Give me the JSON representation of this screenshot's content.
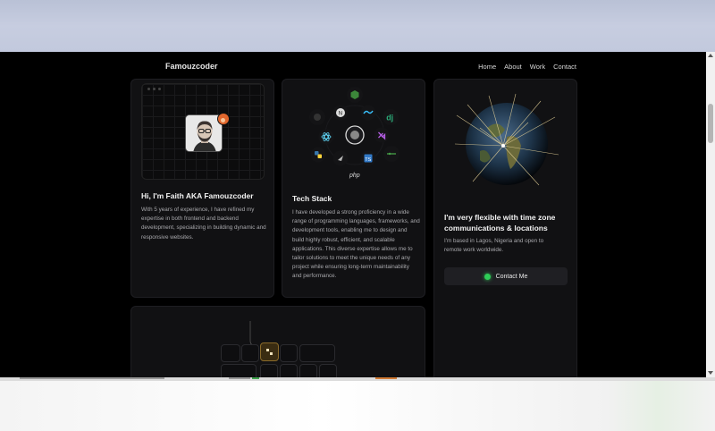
{
  "nav": {
    "brand": "Famouzcoder",
    "links": [
      "Home",
      "About",
      "Work",
      "Contact"
    ]
  },
  "card_intro": {
    "title": "Hi, I'm Faith AKA Famouzcoder",
    "text": "With 5 years of experience, I have refined my expertise in both frontend and backend development, specializing in building dynamic and responsive websites."
  },
  "card_stack": {
    "title": "Tech Stack",
    "text": "I have developed a strong proficiency in a wide range of programming languages, frameworks, and development tools, enabling me to design and build highly robust, efficient, and scalable applications. This diverse expertise allows me to tailor solutions to meet the unique needs of any project while ensuring long-term maintainability and performance.",
    "icons": {
      "django": "dj",
      "typescript": "TS",
      "php": "php"
    }
  },
  "card_location": {
    "title": "I'm very flexible with time zone communications & locations",
    "text": "I'm based in Lagos, Nigeria and open to remote work worldwide.",
    "button": "Contact Me"
  },
  "colors": {
    "accent_green": "#2ecc57",
    "badge_orange": "#e2672d",
    "background": "#000000",
    "card": "#111113"
  }
}
